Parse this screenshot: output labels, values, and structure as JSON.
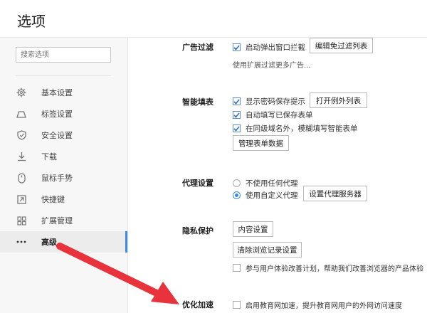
{
  "page": {
    "title": "选项"
  },
  "search": {
    "placeholder": "搜索选项"
  },
  "sidebar": {
    "items": [
      {
        "label": "基本设置",
        "icon": "gear-icon"
      },
      {
        "label": "标签设置",
        "icon": "tab-icon"
      },
      {
        "label": "安全设置",
        "icon": "shield-icon"
      },
      {
        "label": "下载",
        "icon": "download-icon"
      },
      {
        "label": "鼠标手势",
        "icon": "mouse-icon"
      },
      {
        "label": "快捷键",
        "icon": "shortcut-arrow-icon"
      },
      {
        "label": "扩展管理",
        "icon": "grid-icon"
      },
      {
        "label": "高级",
        "icon": "more-dots-icon",
        "active": true
      }
    ]
  },
  "sections": {
    "adblock": {
      "label": "广告过滤",
      "checkbox": "启动弹出窗口拦截",
      "checked": true,
      "button": "编辑免过滤列表",
      "hint": "使用扩展过滤更多广告..."
    },
    "autofill": {
      "label": "智能填表",
      "checkboxes": [
        {
          "label": "显示密码保存提示",
          "checked": true
        },
        {
          "label": "自动填写已保存表单",
          "checked": true
        },
        {
          "label": "在同级域名外，模糊填写智能表单",
          "checked": true
        }
      ],
      "exception_button": "打开例外列表",
      "manage_button": "管理表单数据"
    },
    "proxy": {
      "label": "代理设置",
      "options": [
        {
          "label": "不使用任何代理",
          "selected": false
        },
        {
          "label": "使用自定义代理",
          "selected": true
        }
      ],
      "button": "设置代理服务器"
    },
    "privacy": {
      "label": "隐私保护",
      "content_button": "内容设置",
      "clear_button": "清除浏览记录设置",
      "checkbox": "参与用户体验改善计划，帮助我们改善浏览器的产品体验",
      "checked": false
    },
    "optimize": {
      "label": "优化加速",
      "checkbox": "启用教育网加速，提升教育网用户的外网访问速度",
      "checked": false
    }
  },
  "colors": {
    "accent": "#3c8ce7",
    "arrow": "#e8323c",
    "check": "#3a6fc4"
  }
}
